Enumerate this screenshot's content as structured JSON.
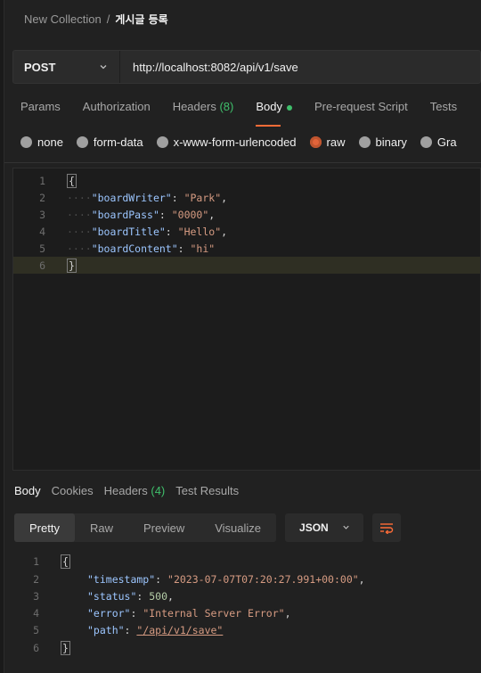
{
  "breadcrumb": {
    "collection": "New Collection",
    "separator": "/",
    "request": "게시글 등록"
  },
  "request": {
    "method": "POST",
    "url": "http://localhost:8082/api/v1/save"
  },
  "tabs": [
    {
      "label": "Params"
    },
    {
      "label": "Authorization"
    },
    {
      "label": "Headers",
      "count": "(8)"
    },
    {
      "label": "Body"
    },
    {
      "label": "Pre-request Script"
    },
    {
      "label": "Tests"
    }
  ],
  "body_types": [
    "none",
    "form-data",
    "x-www-form-urlencoded",
    "raw",
    "binary",
    "Gra"
  ],
  "selected_body_type": "raw",
  "request_body": {
    "line_numbers": [
      "1",
      "2",
      "3",
      "4",
      "5",
      "6"
    ],
    "open": "{",
    "close": "}",
    "indent": "····",
    "fields": [
      {
        "key": "\"boardWriter\"",
        "value": "\"Park\"",
        "comma": ","
      },
      {
        "key": "\"boardPass\"",
        "value": "\"0000\"",
        "comma": ","
      },
      {
        "key": "\"boardTitle\"",
        "value": "\"Hello\"",
        "comma": ","
      },
      {
        "key": "\"boardContent\"",
        "value": "\"hi\"",
        "comma": ""
      }
    ]
  },
  "response_tabs": [
    {
      "label": "Body"
    },
    {
      "label": "Cookies"
    },
    {
      "label": "Headers",
      "count": "(4)"
    },
    {
      "label": "Test Results"
    }
  ],
  "view_modes": [
    "Pretty",
    "Raw",
    "Preview",
    "Visualize"
  ],
  "selected_view_mode": "Pretty",
  "format": "JSON",
  "response_body": {
    "line_numbers": [
      "1",
      "2",
      "3",
      "4",
      "5",
      "6"
    ],
    "open": "{",
    "close": "}",
    "fields": [
      {
        "key": "\"timestamp\"",
        "value": "\"2023-07-07T07:20:27.991+00:00\"",
        "comma": ","
      },
      {
        "key": "\"status\"",
        "value": "500",
        "comma": ","
      },
      {
        "key": "\"error\"",
        "value": "\"Internal Server Error\"",
        "comma": ","
      },
      {
        "key": "\"path\"",
        "value": "\"/api/v1/save\"",
        "comma": ""
      }
    ]
  },
  "colors": {
    "accent": "#ff6c37",
    "count_green": "#3fbf6b",
    "key": "#9cc6ff",
    "string": "#d69b82"
  },
  "icons": {
    "method_dropdown": "chevron-down-icon",
    "format_dropdown": "chevron-down-icon",
    "wrap": "wrap-lines-icon"
  }
}
